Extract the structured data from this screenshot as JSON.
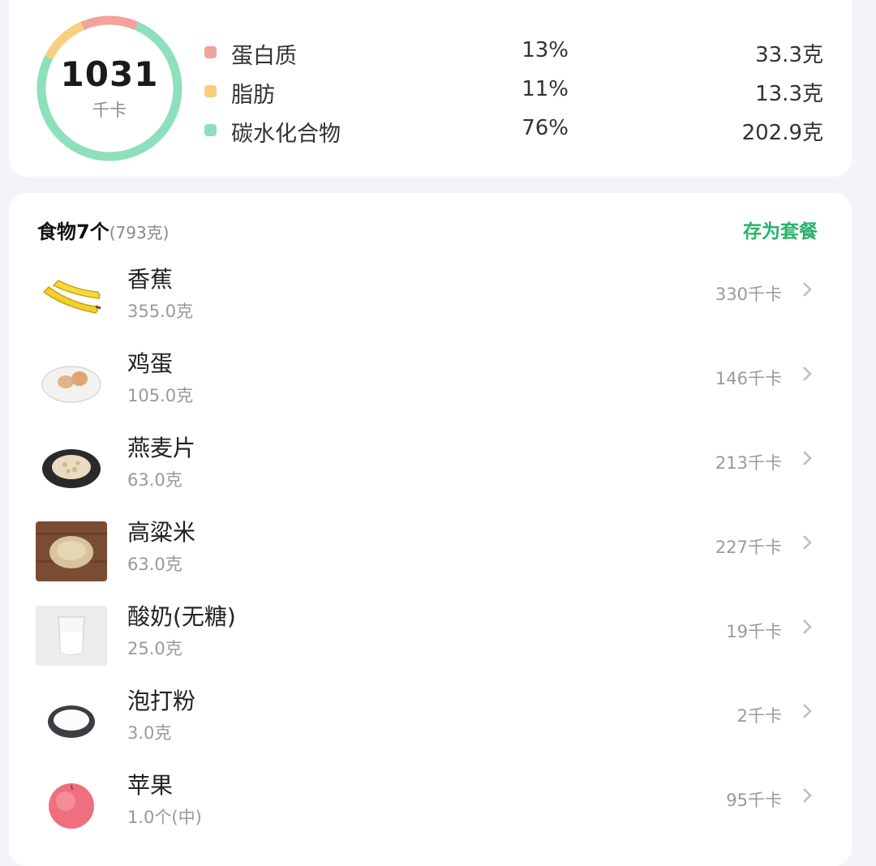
{
  "summary": {
    "kcal": "1031",
    "kcal_unit": "千卡",
    "macros": [
      {
        "name": "蛋白质",
        "pct": "13%",
        "amount": "33.3克",
        "color": "#f4a29c",
        "share": 13
      },
      {
        "name": "脂肪",
        "pct": "11%",
        "amount": "13.3克",
        "color": "#f8cf7c",
        "share": 11
      },
      {
        "name": "碳水化合物",
        "pct": "76%",
        "amount": "202.9克",
        "color": "#8ee0bd",
        "share": 76
      }
    ]
  },
  "foods": {
    "title": "食物7个",
    "total_weight": "(793克)",
    "save_label": "存为套餐",
    "items": [
      {
        "name": "香蕉",
        "amount": "355.0克",
        "kcal": "330千卡",
        "icon": "banana-icon"
      },
      {
        "name": "鸡蛋",
        "amount": "105.0克",
        "kcal": "146千卡",
        "icon": "egg-icon"
      },
      {
        "name": "燕麦片",
        "amount": "63.0克",
        "kcal": "213千卡",
        "icon": "oatmeal-icon"
      },
      {
        "name": "高粱米",
        "amount": "63.0克",
        "kcal": "227千卡",
        "icon": "sorghum-icon"
      },
      {
        "name": "酸奶(无糖)",
        "amount": "25.0克",
        "kcal": "19千卡",
        "icon": "yogurt-icon"
      },
      {
        "name": "泡打粉",
        "amount": "3.0克",
        "kcal": "2千卡",
        "icon": "baking-powder-icon"
      },
      {
        "name": "苹果",
        "amount": "1.0个(中)",
        "kcal": "95千卡",
        "icon": "apple-icon"
      }
    ]
  },
  "colors": {
    "accent": "#27b36b"
  }
}
